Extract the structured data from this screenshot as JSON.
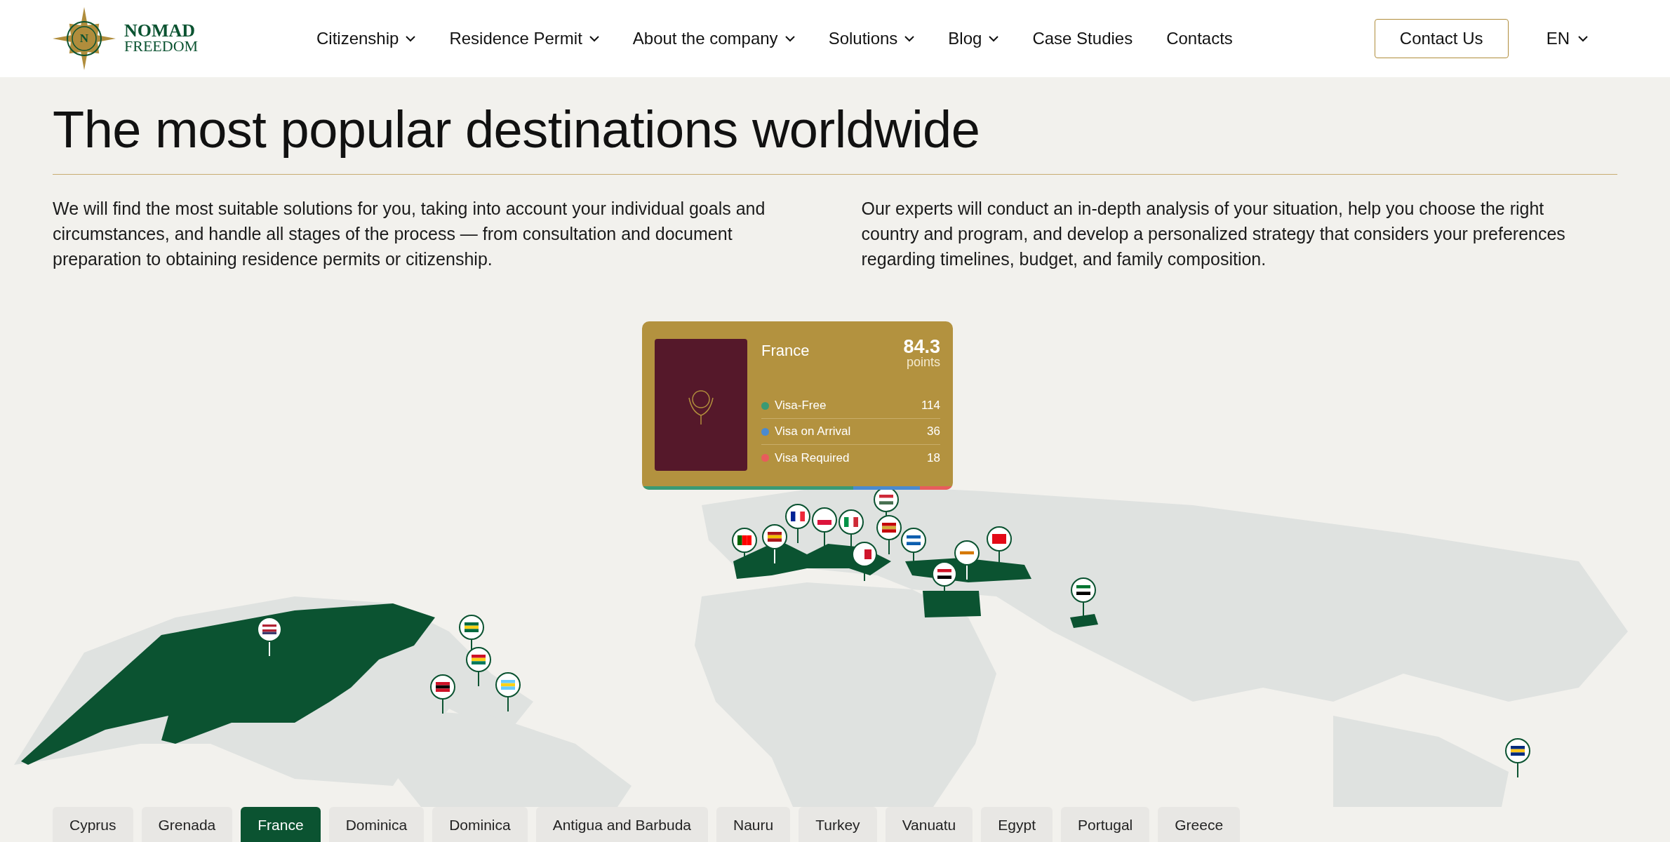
{
  "logo": {
    "mark": "N",
    "line1": "NOMAD",
    "line2": "FREEDOM"
  },
  "nav": [
    {
      "label": "Citizenship",
      "dropdown": true
    },
    {
      "label": "Residence Permit",
      "dropdown": true
    },
    {
      "label": "About the company",
      "dropdown": true
    },
    {
      "label": "Solutions",
      "dropdown": true
    },
    {
      "label": "Blog",
      "dropdown": true
    },
    {
      "label": "Case Studies",
      "dropdown": false
    },
    {
      "label": "Contacts",
      "dropdown": false
    }
  ],
  "contact_button": "Contact Us",
  "language": "EN",
  "heading": "The most popular destinations worldwide",
  "paragraphs": [
    "We will find the most suitable solutions for you, taking into account your individual goals and circumstances, and handle all stages of the process — from consultation and document preparation to obtaining residence permits or citizenship.",
    "Our experts will conduct an in-depth analysis of your situation, help you choose the right country and program, and develop a personalized strategy that considers your preferences regarding timelines, budget, and family composition."
  ],
  "card": {
    "country": "France",
    "score": "84.3",
    "score_unit": "points",
    "stats": [
      {
        "label": "Visa-Free",
        "value": "114",
        "color": "#3a9a74"
      },
      {
        "label": "Visa on Arrival",
        "value": "36",
        "color": "#4a8ad0"
      },
      {
        "label": "Visa Required",
        "value": "18",
        "color": "#e85c5c"
      }
    ]
  },
  "tabs": [
    {
      "label": "Cyprus",
      "selected": false
    },
    {
      "label": "Grenada",
      "selected": false
    },
    {
      "label": "France",
      "selected": true
    },
    {
      "label": "Dominica",
      "selected": false
    },
    {
      "label": "Dominica",
      "selected": false
    },
    {
      "label": "Antigua and Barbuda",
      "selected": false
    },
    {
      "label": "Nauru",
      "selected": false
    },
    {
      "label": "Turkey",
      "selected": false
    },
    {
      "label": "Vanuatu",
      "selected": false
    },
    {
      "label": "Egypt",
      "selected": false
    },
    {
      "label": "Portugal",
      "selected": false
    },
    {
      "label": "Greece",
      "selected": false
    }
  ]
}
